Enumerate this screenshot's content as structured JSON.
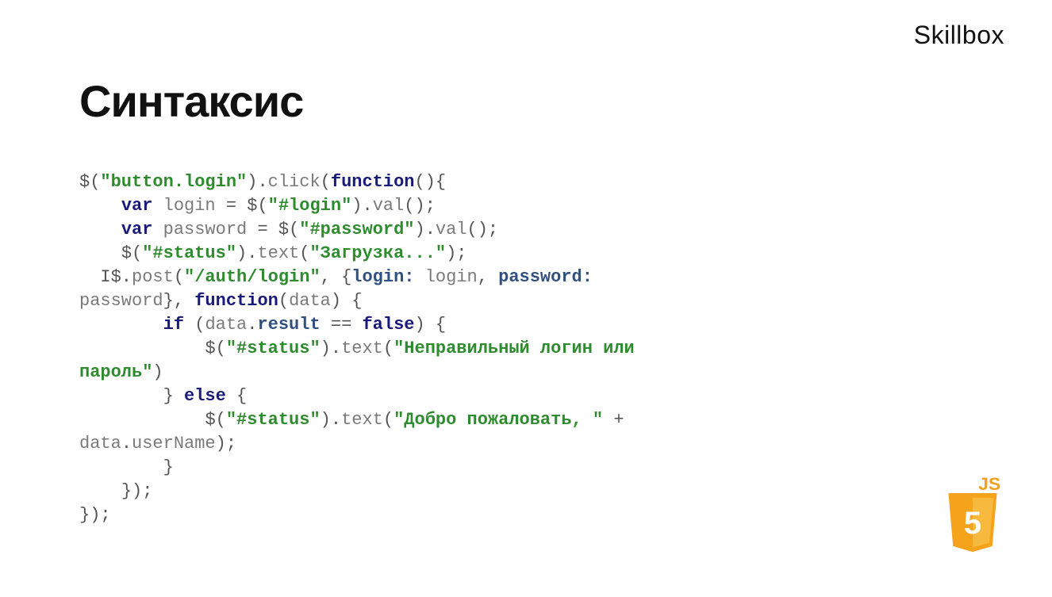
{
  "brand": "Skillbox",
  "title": "Синтаксис",
  "code": {
    "line1_selector": "\"button.login\"",
    "line1_click": "click",
    "line1_function": "function",
    "line2_var": "var",
    "line2_login": "login",
    "line2_login_sel": "\"#login\"",
    "line2_val": "val",
    "line3_var": "var",
    "line3_password": "password",
    "line3_pass_sel": "\"#password\"",
    "line3_val": "val",
    "line4_status_sel": "\"#status\"",
    "line4_text": "text",
    "line4_loading": "\"Загрузка...\"",
    "line5_cursor": "I",
    "line5_post": "post",
    "line5_url": "\"/auth/login\"",
    "line5_login_prop": "login:",
    "line5_login_var": "login",
    "line6_pass_prop": "password:",
    "line6_pass_var": "password",
    "line6_function": "function",
    "line6_data": "data",
    "line7_if": "if",
    "line7_data": "data",
    "line7_result": "result",
    "line7_false": "false",
    "line8_status_sel": "\"#status\"",
    "line8_text": "text",
    "line8_msg": "\"Неправильный логин или пароль\"",
    "line9_else": "else",
    "line10_status_sel": "\"#status\"",
    "line10_text": "text",
    "line10_msg": "\"Добро пожаловать, \"",
    "line10_data": "data",
    "line10_userName": "userName"
  },
  "badge": {
    "label": "JS",
    "five": "5"
  }
}
